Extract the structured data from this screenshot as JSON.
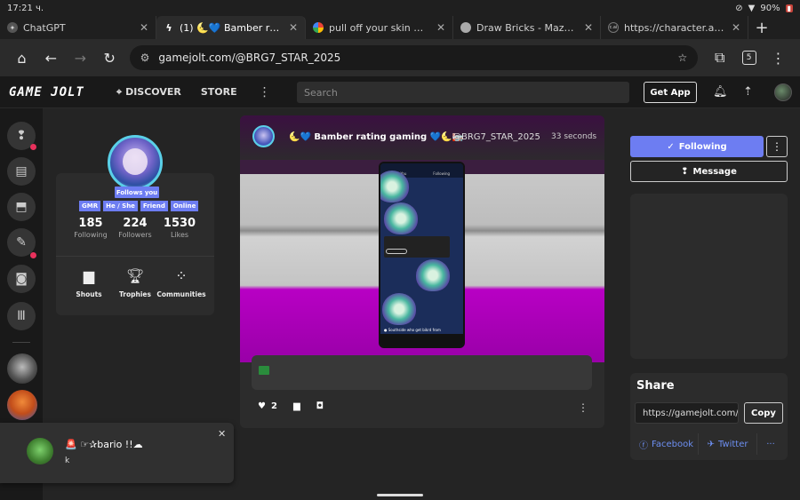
{
  "status": {
    "time": "17:21 ч.",
    "battery": "90%"
  },
  "tabs": [
    {
      "title": "ChatGPT"
    },
    {
      "title": "(1) 🌜💙 Bamber rating gam"
    },
    {
      "title": "pull off your skin mcqueen -"
    },
    {
      "title": "Draw Bricks - Mazda Miata |"
    },
    {
      "title": "https://character.ai/profile/"
    }
  ],
  "browser": {
    "url": "gamejolt.com/@BRG7_STAR_2025",
    "tab_count": "5"
  },
  "header": {
    "logo": "GAME JOLT",
    "discover": "DISCOVER",
    "store": "STORE",
    "search_placeholder": "Search",
    "get_app": "Get App"
  },
  "profile": {
    "follows_you": "Follows you",
    "tags": [
      "GMR",
      "He / She",
      "Friend",
      "Online"
    ],
    "stats": [
      {
        "num": "185",
        "label": "Following"
      },
      {
        "num": "224",
        "label": "Followers"
      },
      {
        "num": "1530",
        "label": "Likes"
      }
    ],
    "buttons": [
      {
        "label": "Shouts"
      },
      {
        "label": "Trophies"
      },
      {
        "label": "Communities"
      }
    ]
  },
  "post": {
    "title": "🌜💙 Bamber rating gaming 💙🌜🏣",
    "handle": "@BRG7_STAR_2025",
    "time": "33 seconds",
    "likes": "2",
    "phone_header": [
      "For You",
      "Following"
    ],
    "phone_caption": "● Southside who get bikrd from"
  },
  "right": {
    "following": "Following",
    "message": "Message",
    "share_title": "Share",
    "share_url": "https://gamejolt.com/",
    "copy": "Copy",
    "facebook": "Facebook",
    "twitter": "Twitter"
  },
  "toast": {
    "name": "🚨 ☞✰bario !!☁",
    "message": "k"
  },
  "colors": {
    "accent": "#6d7df2",
    "notification_dot": "#e8315c"
  }
}
